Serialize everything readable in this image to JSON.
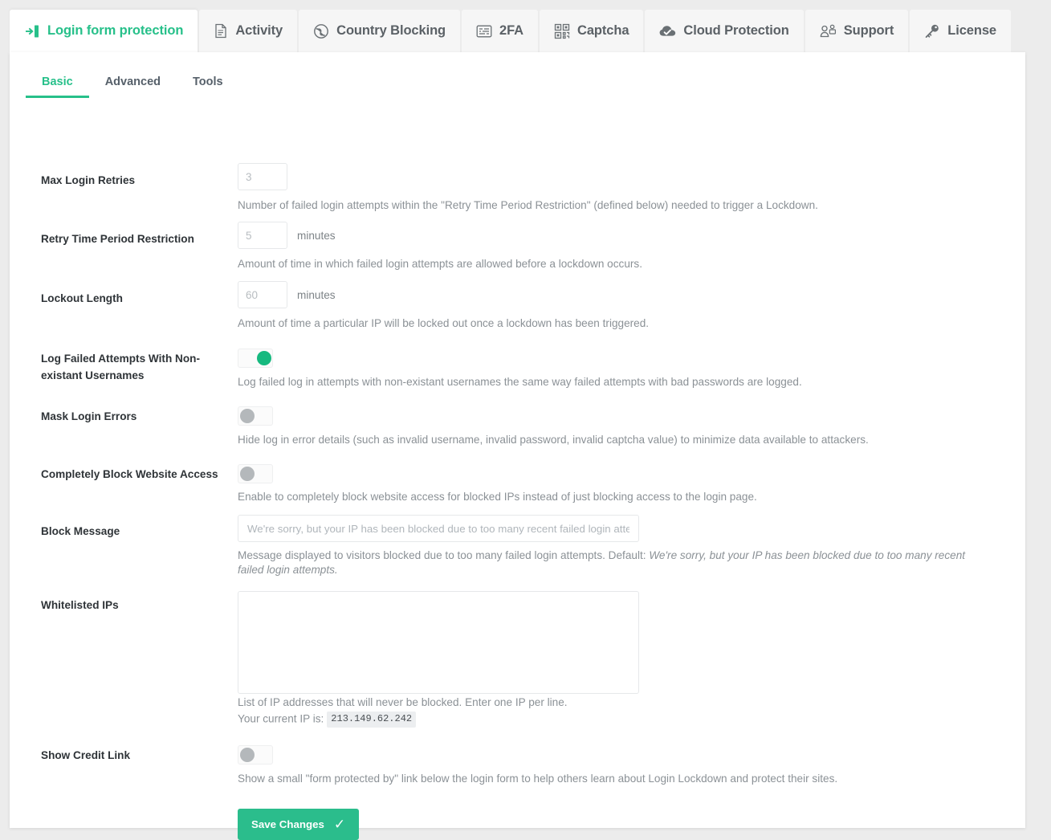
{
  "tabs": [
    {
      "label": "Login form protection",
      "icon": "login-door-icon",
      "active": true
    },
    {
      "label": "Activity",
      "icon": "document-icon",
      "active": false
    },
    {
      "label": "Country Blocking",
      "icon": "globe-icon",
      "active": false
    },
    {
      "label": "2FA",
      "icon": "keypad-icon",
      "active": false
    },
    {
      "label": "Captcha",
      "icon": "captcha-icon",
      "active": false
    },
    {
      "label": "Cloud Protection",
      "icon": "cloud-check-icon",
      "active": false
    },
    {
      "label": "Support",
      "icon": "people-icon",
      "active": false
    },
    {
      "label": "License",
      "icon": "key-icon",
      "active": false
    }
  ],
  "subtabs": [
    {
      "label": "Basic",
      "active": true
    },
    {
      "label": "Advanced",
      "active": false
    },
    {
      "label": "Tools",
      "active": false
    }
  ],
  "colors": {
    "accent": "#27c08a",
    "toggle_on": "#16b97f",
    "toggle_off": "#b4b8bb",
    "save_button": "#2bbd8c",
    "label_text": "#2f3438",
    "description_text": "#8b9196",
    "page_background": "#ececec"
  },
  "fields": {
    "max_login_retries": {
      "label": "Max Login Retries",
      "value": "",
      "placeholder": "3",
      "description": "Number of failed login attempts within the \"Retry Time Period Restriction\" (defined below) needed to trigger a Lockdown."
    },
    "retry_time_period": {
      "label": "Retry Time Period Restriction",
      "value": "",
      "placeholder": "5",
      "unit": "minutes",
      "description": "Amount of time in which failed login attempts are allowed before a lockdown occurs."
    },
    "lockout_length": {
      "label": "Lockout Length",
      "value": "",
      "placeholder": "60",
      "unit": "minutes",
      "description": "Amount of time a particular IP will be locked out once a lockdown has been triggered."
    },
    "log_failed_attempts": {
      "label": "Log Failed Attempts With Non-existant Usernames",
      "state": "on",
      "description": "Log failed log in attempts with non-existant usernames the same way failed attempts with bad passwords are logged."
    },
    "mask_login_errors": {
      "label": "Mask Login Errors",
      "state": "off",
      "description": "Hide log in error details (such as invalid username, invalid password, invalid captcha value) to minimize data available to attackers."
    },
    "completely_block": {
      "label": "Completely Block Website Access",
      "state": "off",
      "description": "Enable to completely block website access for blocked IPs instead of just blocking access to the login page."
    },
    "block_message": {
      "label": "Block Message",
      "value": "",
      "placeholder": "We're sorry, but your IP has been blocked due to too many recent failed login attempts.",
      "description_prefix": "Message displayed to visitors blocked due to too many failed login attempts. Default: ",
      "description_default": "We're sorry, but your IP has been blocked due to too many recent failed login attempts."
    },
    "whitelisted_ips": {
      "label": "Whitelisted IPs",
      "value": "",
      "placeholder": "",
      "description": "List of IP addresses that will never be blocked. Enter one IP per line.",
      "current_ip_label": "Your current IP is:",
      "current_ip": "213.149.62.242"
    },
    "show_credit_link": {
      "label": "Show Credit Link",
      "state": "off",
      "description": "Show a small \"form protected by\" link below the login form to help others learn about Login Lockdown and protect their sites."
    }
  },
  "save": {
    "label": "Save Changes",
    "check_icon": "✓"
  }
}
